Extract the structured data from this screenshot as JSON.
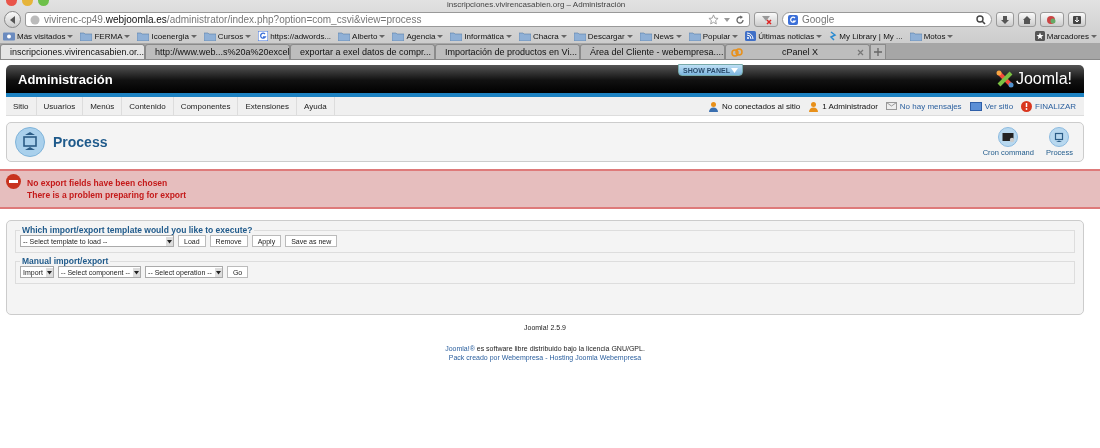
{
  "browser": {
    "title": "inscripciones.vivirencasabien.org – Administración",
    "url": {
      "host_prefix": "vivirenc-cp49.",
      "host": "webjoomla.es",
      "path": "/administrator/index.php?option=com_csvi&view=process"
    },
    "search": {
      "placeholder": "Google"
    },
    "bookmarks": [
      {
        "label": "Más visitados",
        "kind": "special",
        "menu": true
      },
      {
        "label": "FERMA",
        "kind": "folder",
        "menu": true
      },
      {
        "label": "Icoenergia",
        "kind": "folder",
        "menu": true
      },
      {
        "label": "Cursos",
        "kind": "folder",
        "menu": true
      },
      {
        "label": "https://adwords...",
        "kind": "site",
        "menu": false
      },
      {
        "label": "Alberto",
        "kind": "folder",
        "menu": true
      },
      {
        "label": "Agencia",
        "kind": "folder",
        "menu": true
      },
      {
        "label": "Informática",
        "kind": "folder",
        "menu": true
      },
      {
        "label": "Chacra",
        "kind": "folder",
        "menu": true
      },
      {
        "label": "Descargar",
        "kind": "folder",
        "menu": true
      },
      {
        "label": "News",
        "kind": "folder",
        "menu": true
      },
      {
        "label": "Popular",
        "kind": "folder",
        "menu": true
      },
      {
        "label": "Últimas noticias",
        "kind": "feed",
        "menu": true
      },
      {
        "label": "My Library | My ...",
        "kind": "link",
        "menu": false
      },
      {
        "label": "Motos",
        "kind": "folder",
        "menu": true
      }
    ],
    "bookmarks_menu": "Marcadores",
    "tabs": [
      {
        "label": "inscripciones.vivirencasabien.or...",
        "kind": "joomla",
        "selected": true
      },
      {
        "label": "http://www.web...s%20a%20excel",
        "kind": "webempresa",
        "selected": false
      },
      {
        "label": "exportar a exel datos de compr...",
        "kind": "webempresa",
        "selected": false
      },
      {
        "label": "Importación de productos en Vi...",
        "kind": "webempresa",
        "selected": false
      },
      {
        "label": "Área del Cliente - webempresa....",
        "kind": "webempresa",
        "selected": false
      },
      {
        "label": "cPanel X",
        "kind": "cpanel",
        "selected": false
      }
    ]
  },
  "admin": {
    "title": "Administración",
    "show_panel": "SHOW PANEL",
    "brand": "Joomla!",
    "menu": [
      "Sitio",
      "Usuarios",
      "Menús",
      "Contenido",
      "Componentes",
      "Extensiones",
      "Ayuda"
    ],
    "status": [
      {
        "label": "No conectados al sitio",
        "kind": "users"
      },
      {
        "label": "1 Administrador",
        "kind": "admin"
      },
      {
        "label": "No hay mensajes",
        "kind": "messages"
      },
      {
        "label": "Ver sitio",
        "kind": "site"
      },
      {
        "label": "FINALIZAR",
        "kind": "logout"
      }
    ]
  },
  "page": {
    "title": "Process",
    "toolbar": [
      {
        "label": "Cron command",
        "kind": "cron"
      },
      {
        "label": "Process",
        "kind": "process"
      }
    ]
  },
  "errors": [
    "No export fields have been chosen",
    "There is a problem preparing for export"
  ],
  "template_section": {
    "legend": "Which import/export template would you like to execute?",
    "select": "-- Select template to load --",
    "buttons": [
      "Load",
      "Remove",
      "Apply",
      "Save as new"
    ]
  },
  "manual_section": {
    "legend": "Manual import/export",
    "selects": [
      "Import",
      "-- Select component --",
      "-- Select operation --"
    ],
    "buttons": [
      "Go"
    ]
  },
  "footer": {
    "version": "Joomla! 2.5.9",
    "license": {
      "link": "Joomla!®",
      "text": "es software libre distribuido bajo la licencia GNU/GPL."
    },
    "credits": {
      "links": [
        "Pack creado por Webempresa",
        "Hosting Joomla Webempresa"
      ],
      "separator": "-"
    }
  }
}
